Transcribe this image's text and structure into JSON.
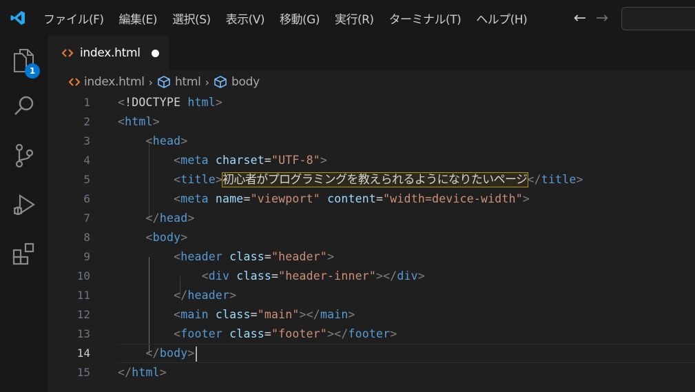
{
  "menu": [
    "ファイル(F)",
    "編集(E)",
    "選択(S)",
    "表示(V)",
    "移動(G)",
    "実行(R)",
    "ターミナル(T)",
    "ヘルプ(H)"
  ],
  "nav": {
    "back": "←",
    "forward": "→"
  },
  "activity": {
    "explorer_badge": "1"
  },
  "tab": {
    "label": "index.html"
  },
  "breadcrumb": {
    "file": "index.html",
    "item1": "html",
    "item2": "body"
  },
  "editor": {
    "line_numbers": [
      "1",
      "2",
      "3",
      "4",
      "5",
      "6",
      "7",
      "8",
      "9",
      "10",
      "11",
      "12",
      "13",
      "14",
      "15"
    ],
    "current_line": 14,
    "doctype_keyword": "!DOCTYPE",
    "doctype_value": "html",
    "tags": {
      "html": "html",
      "head": "head",
      "meta": "meta",
      "title": "title",
      "body": "body",
      "header": "header",
      "div": "div",
      "main": "main",
      "footer": "footer"
    },
    "attrs": {
      "charset": "charset",
      "name": "name",
      "content": "content",
      "class": "class"
    },
    "strings": {
      "utf8": "\"UTF-8\"",
      "viewport": "\"viewport\"",
      "device_width": "\"width=device-width\"",
      "header": "\"header\"",
      "header_inner": "\"header-inner\"",
      "main": "\"main\"",
      "footer": "\"footer\""
    },
    "title_text": "初心者がプログラミングを教えられるようになりたいページ"
  },
  "colors": {
    "accent": "#0078d4",
    "tag": "#569cd6",
    "attr": "#9cdcfe",
    "string": "#ce9178",
    "bracket": "#808080",
    "editor_bg": "#1f1f1f",
    "html_icon": "#e37933",
    "symbol_icon": "#75beff"
  }
}
